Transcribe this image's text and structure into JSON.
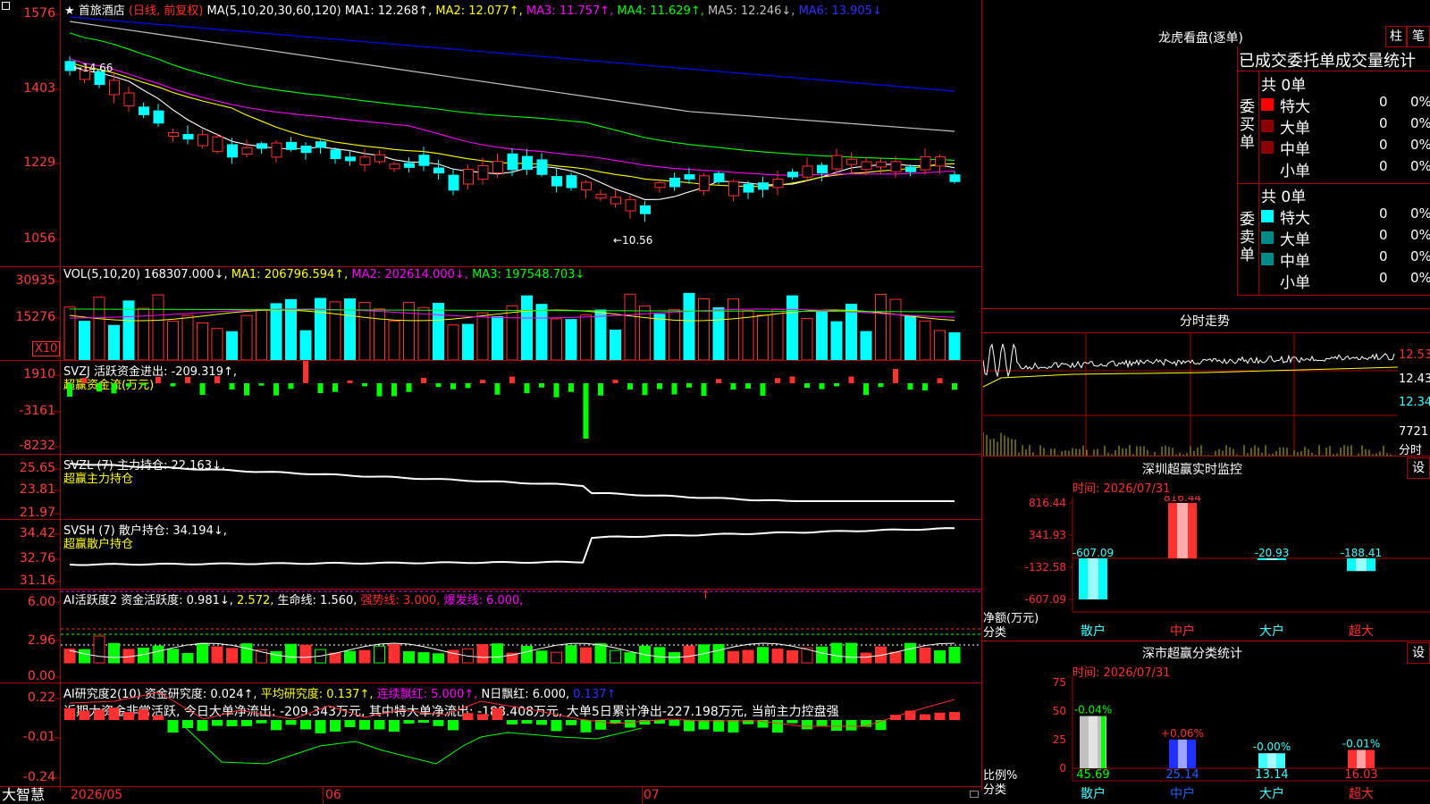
{
  "stock": {
    "star": "★",
    "name": "首旅酒店",
    "period": "(日线, 前复权)",
    "ma_header": "MA(5,10,20,30,60,120)",
    "ma1": "MA1: 12.268↑,",
    "ma2": "MA2: 12.077↑,",
    "ma3": "MA3: 11.757↑,",
    "ma4": "MA4: 11.629↑,",
    "ma5": "MA5: 12.246↓,",
    "ma6": "MA6: 13.905↓",
    "high_mark": "←14.66",
    "low_mark": "←10.56",
    "y_ticks": [
      "1576",
      "1403",
      "1229",
      "1056"
    ]
  },
  "vol": {
    "label": "VOL(5,10,20)",
    "value": "168307.000↓,",
    "ma1": "MA1: 206796.594↑,",
    "ma2": "MA2: 202614.000↓,",
    "ma3": "MA3: 197548.703↓",
    "y_ticks": [
      "30935",
      "15276"
    ],
    "unit": "X10"
  },
  "svzj": {
    "label": "SVZJ  活跃资金进出: -209.319↑,",
    "sub": "超赢资金流(万元)",
    "y_ticks": [
      "1910",
      "-3161",
      "-8232"
    ]
  },
  "svzl": {
    "label": "SVZL (7) 主力持仓: 22.163↓,",
    "sub": "超赢主力持仓",
    "y_ticks": [
      "25.65",
      "23.81",
      "21.97"
    ]
  },
  "svsh": {
    "label": "SVSH (7) 散户持仓: 34.194↓,",
    "sub": "超赢散户持仓",
    "y_ticks": [
      "34.42",
      "32.76",
      "31.16"
    ]
  },
  "ai_active": {
    "label": "AI活跃度2 资金活跃度: 0.981↓,",
    "v2": "2.572,",
    "life": "生命线: 1.560,",
    "strong": "强势线: 3.000,",
    "burst": "爆发线: 6.000,",
    "arrow": "↑",
    "y_ticks": [
      "6.00",
      "2.96",
      "0.00"
    ]
  },
  "ai_research": {
    "label": "AI研究度2(10) 资金研究度: 0.024↑,",
    "avg": "平均研究度: 0.137↑,",
    "cont": "连续飘红: 5.000↑,",
    "nday": "N日飘红: 6.000,",
    "last": "0.137↑",
    "comment": "近期大资金非常活跃, 今日大单净流出: -209.343万元, 其中特大单净流出: -188.408万元, 大单5日累计净出-227.198万元, 当前主力控盘强",
    "y_ticks": [
      "0.22",
      "-0.01",
      "-0.24"
    ]
  },
  "footer": {
    "brand": "大智慧",
    "date1": "2026/05",
    "date2": "06",
    "date3": "07"
  },
  "longhu": {
    "title": "龙虎看盘(逐单)",
    "btn_bar": "柱",
    "btn_pen": "笔",
    "tabs": "已成交委托单成交量统计",
    "buy_label": "委买单",
    "sell_label": "委卖单",
    "buy_total": "共 0单",
    "sell_total": "共 0单",
    "buy_rows": [
      {
        "name": "特大",
        "count": "0",
        "pct": "0%"
      },
      {
        "name": "大单",
        "count": "0",
        "pct": "0%"
      },
      {
        "name": "中单",
        "count": "0",
        "pct": "0%"
      },
      {
        "name": "小单",
        "count": "0",
        "pct": "0%"
      }
    ],
    "sell_rows": [
      {
        "name": "特大",
        "count": "0",
        "pct": "0%"
      },
      {
        "name": "大单",
        "count": "0",
        "pct": "0%"
      },
      {
        "name": "中单",
        "count": "0",
        "pct": "0%"
      },
      {
        "name": "小单",
        "count": "0",
        "pct": "0%"
      }
    ]
  },
  "intraday": {
    "title": "分时走势",
    "p1": "12.53",
    "p2": "12.43",
    "p3": "12.34",
    "vol": "7721",
    "vol_unit": "分时"
  },
  "monitor": {
    "title": "深圳超赢实时监控",
    "setting": "设",
    "time": "时间: 2026/07/31",
    "y_ticks": [
      "816.44",
      "341.93",
      "-132.58",
      "-607.09"
    ],
    "y_unit": "净额(万元)",
    "x_unit": "分类",
    "bars": [
      {
        "name": "散户",
        "value": -607.09,
        "label": "-607.09"
      },
      {
        "name": "中户",
        "value": 816.44,
        "label": "816.44"
      },
      {
        "name": "大户",
        "value": -20.93,
        "label": "-20.93"
      },
      {
        "name": "超大",
        "value": -188.41,
        "label": "-188.41"
      }
    ]
  },
  "classify": {
    "title": "深市超赢分类统计",
    "setting": "设",
    "time": "时间: 2026/07/31",
    "y_ticks": [
      "75",
      "50",
      "25",
      "0"
    ],
    "y_unit": "比例%",
    "x_unit": "分类",
    "bars": [
      {
        "name": "散户",
        "value": 45.69,
        "label": "45.69",
        "change": "-0.04%"
      },
      {
        "name": "中户",
        "value": 25.14,
        "label": "25.14",
        "change": "+0.06%"
      },
      {
        "name": "大户",
        "value": 13.14,
        "label": "13.14",
        "change": "-0.00%"
      },
      {
        "name": "超大",
        "value": 16.03,
        "label": "16.03",
        "change": "-0.01%"
      }
    ]
  },
  "colors": {
    "up": "#ff3030",
    "down": "#00ffff",
    "grid": "#a80000",
    "ma1": "#ffffff",
    "ma2": "#ffff00",
    "ma3": "#ff00ff",
    "ma4": "#00ff00",
    "ma5": "#c0c0c0",
    "ma6": "#0000ff"
  }
}
